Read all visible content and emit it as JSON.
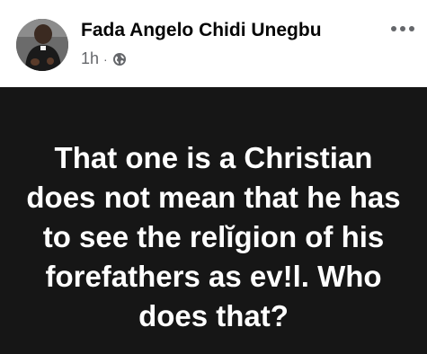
{
  "author": {
    "name": "Fada Angelo Chidi Unegbu"
  },
  "post": {
    "time": "1h",
    "separator": "·",
    "audience_icon": "globe-icon",
    "text": "That one is a Christian does not mean that he has to see the relĭgion of his forefathers as ev!l. Who does that?"
  },
  "icons": {
    "more": "more-horizontal-icon"
  },
  "colors": {
    "name": "#050505",
    "meta": "#65676b",
    "post_background": "#161616",
    "post_text": "#ffffff"
  }
}
